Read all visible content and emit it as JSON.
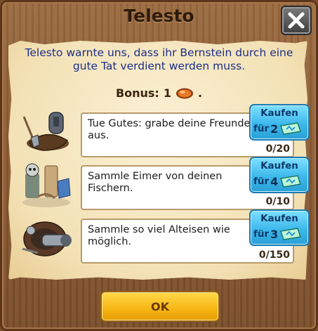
{
  "dialog": {
    "title": "Telesto",
    "intro": "Telesto warnte uns, dass ihr Bernstein durch eine gute Tat verdient werden muss.",
    "bonus_label": "Bonus:",
    "bonus_value": "1",
    "bonus_suffix": ".",
    "bonus_icon": "amber-icon",
    "ok_label": "OK"
  },
  "tasks": [
    {
      "icon": "grave-shovel-icon",
      "text": "Tue Gutes: grabe deine Freunde aus.",
      "progress": "0/20",
      "buy_top": "Kaufen",
      "buy_for": "für",
      "buy_cost": "2"
    },
    {
      "icon": "fisherman-bucket-icon",
      "text": "Sammle Eimer von deinen Fischern.",
      "progress": "0/10",
      "buy_top": "Kaufen",
      "buy_for": "für",
      "buy_cost": "4"
    },
    {
      "icon": "scrap-metal-icon",
      "text": "Sammle so viel Alteisen wie möglich.",
      "progress": "0/150",
      "buy_top": "Kaufen",
      "buy_for": "für",
      "buy_cost": "3"
    }
  ],
  "colors": {
    "intro_text": "#1b2e8a",
    "buy_button": "#3cb8ec",
    "ok_button": "#f7b614",
    "parchment": "#f3e1b5",
    "wood": "#8a5a33"
  }
}
